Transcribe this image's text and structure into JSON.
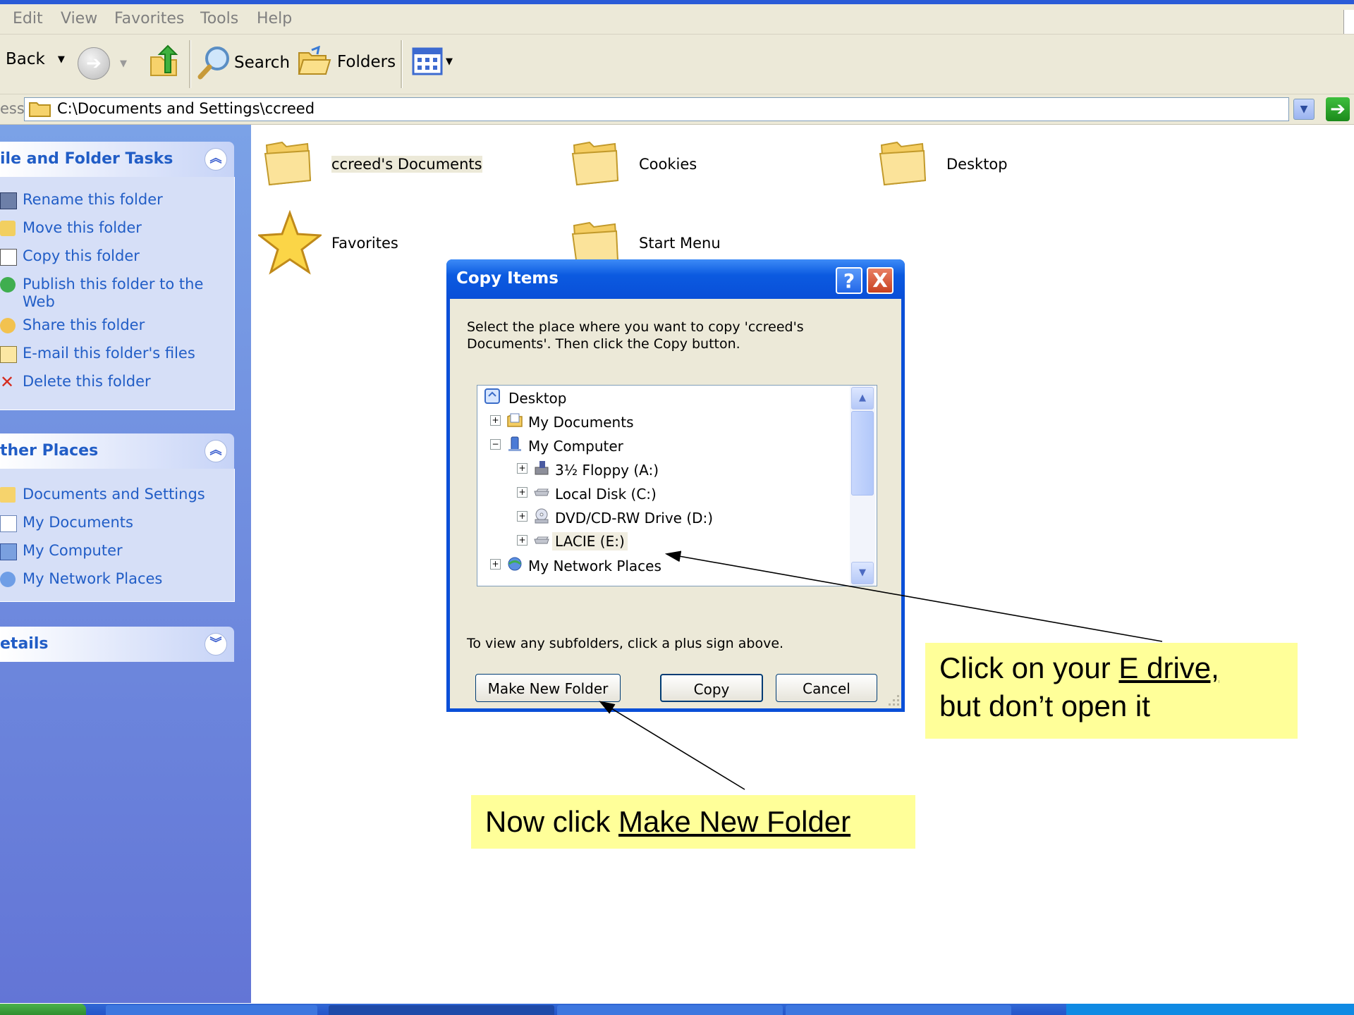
{
  "menu": {
    "items": [
      "Edit",
      "View",
      "Favorites",
      "Tools",
      "Help"
    ]
  },
  "toolbar": {
    "back_label": "Back",
    "search_label": "Search",
    "folders_label": "Folders"
  },
  "address": {
    "label": "ess",
    "path": "C:\\Documents and Settings\\ccreed"
  },
  "task_pane": {
    "file_tasks": {
      "title": "ile and Folder Tasks",
      "items": [
        "Rename this folder",
        "Move this folder",
        "Copy this folder",
        "Publish this folder to the Web",
        "Share this folder",
        "E-mail this folder's files",
        "Delete this folder"
      ]
    },
    "other_places": {
      "title": "ther Places",
      "items": [
        "Documents and Settings",
        "My Documents",
        "My Computer",
        "My Network Places"
      ]
    },
    "details": {
      "title": "etails"
    }
  },
  "content": {
    "items": [
      "ccreed's Documents",
      "Cookies",
      "Desktop",
      "Favorites",
      "Start Menu"
    ]
  },
  "dialog": {
    "title": "Copy Items",
    "help": "?",
    "close": "X",
    "instruction": "Select the place where you want to copy 'ccreed's Documents'. Then click the Copy button.",
    "tree": [
      "Desktop",
      "My Documents",
      "My Computer",
      "3½ Floppy (A:)",
      "Local Disk (C:)",
      "DVD/CD-RW Drive (D:)",
      "LACIE (E:)",
      "My Network Places"
    ],
    "note": "To view any subfolders, click a plus sign above.",
    "buttons": {
      "make_new_folder": "Make New Folder",
      "copy": "Copy",
      "cancel": "Cancel"
    }
  },
  "callouts": {
    "e_drive": {
      "prefix": "Click on your ",
      "link": "E drive,",
      "line2": "but don’t open it"
    },
    "new_folder": {
      "prefix": "Now click ",
      "link": "Make New Folder"
    }
  },
  "colors": {
    "task_pane_link": "#215dc6",
    "xp_title_blue": "#0a4fd8",
    "callout_bg": "#ffff99"
  },
  "icons": [
    "forward-icon",
    "up-folder-icon",
    "search-icon",
    "folders-icon",
    "views-icon",
    "folder-icon",
    "star-icon",
    "desktop-icon",
    "my-computer-icon",
    "floppy-icon",
    "disk-icon",
    "cdrom-icon",
    "network-icon",
    "rename-icon",
    "move-icon",
    "copy-icon",
    "publish-icon",
    "share-icon",
    "email-icon",
    "delete-icon"
  ]
}
